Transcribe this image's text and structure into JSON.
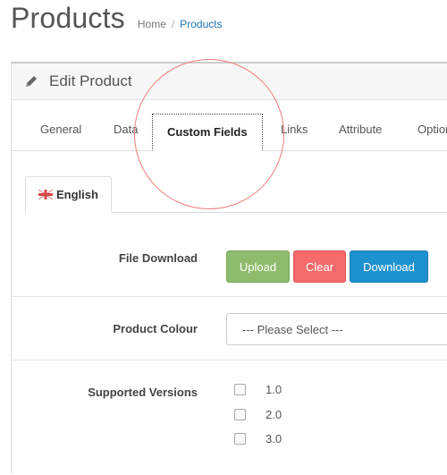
{
  "page": {
    "title": "Products"
  },
  "breadcrumb": {
    "items": [
      "Home",
      "Products"
    ],
    "separator": "/"
  },
  "panel": {
    "heading": "Edit Product",
    "icon": "pencil-icon"
  },
  "tabs": [
    {
      "label": "General"
    },
    {
      "label": "Data"
    },
    {
      "label": "Custom Fields",
      "active": true
    },
    {
      "label": "Links"
    },
    {
      "label": "Attribute"
    },
    {
      "label": "Option"
    }
  ],
  "language_tab": {
    "label": "English",
    "icon": "uk-flag-icon"
  },
  "fields": {
    "file_download": {
      "label": "File Download",
      "upload_label": "Upload",
      "clear_label": "Clear",
      "download_label": "Download"
    },
    "product_colour": {
      "label": "Product Colour",
      "selected": "--- Please Select ---"
    },
    "supported_versions": {
      "label": "Supported Versions",
      "options": [
        {
          "label": "1.0",
          "checked": false
        },
        {
          "label": "2.0",
          "checked": false
        },
        {
          "label": "3.0",
          "checked": false
        }
      ]
    }
  },
  "colors": {
    "upload": "#8fbb6c",
    "clear": "#f56b6b",
    "download": "#1e91cf",
    "link": "#1f75b6",
    "highlight": "#f07c7c"
  }
}
